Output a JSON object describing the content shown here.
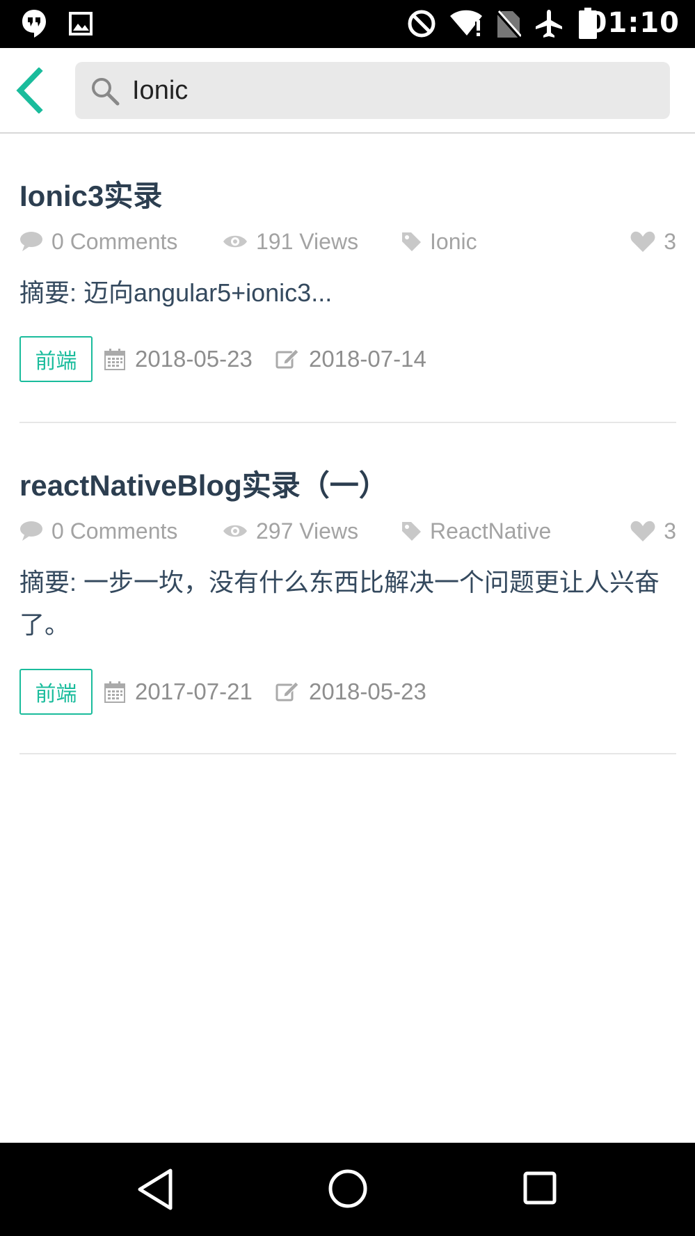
{
  "status_bar": {
    "time": "01:10",
    "left_icons": [
      "hangouts-icon",
      "image-icon"
    ],
    "right_icons": [
      "do-not-disturb-icon",
      "wifi-alert-icon",
      "no-sim-icon",
      "airplane-mode-icon",
      "battery-icon"
    ]
  },
  "header": {
    "back_icon": "chevron-left-icon",
    "search_icon": "search-icon",
    "search_value": "Ionic"
  },
  "colors": {
    "accent": "#1abc9c",
    "title": "#2c3e50",
    "meta": "#a3a3a3",
    "summary": "#34495e"
  },
  "articles": [
    {
      "title": "Ionic3实录",
      "comments": "0 Comments",
      "views": "191 Views",
      "tag": "Ionic",
      "likes": "3",
      "summary": "摘要: 迈向angular5+ionic3...",
      "category": "前端",
      "created": "2018-05-23",
      "updated": "2018-07-14"
    },
    {
      "title": "reactNativeBlog实录（一）",
      "comments": "0 Comments",
      "views": "297 Views",
      "tag": "ReactNative",
      "likes": "3",
      "summary": "摘要: 一步一坎，没有什么东西比解决一个问题更让人兴奋了。",
      "category": "前端",
      "created": "2017-07-21",
      "updated": "2018-05-23"
    }
  ],
  "nav_bar": {
    "buttons": [
      "back-triangle-icon",
      "home-circle-icon",
      "recents-square-icon"
    ]
  }
}
